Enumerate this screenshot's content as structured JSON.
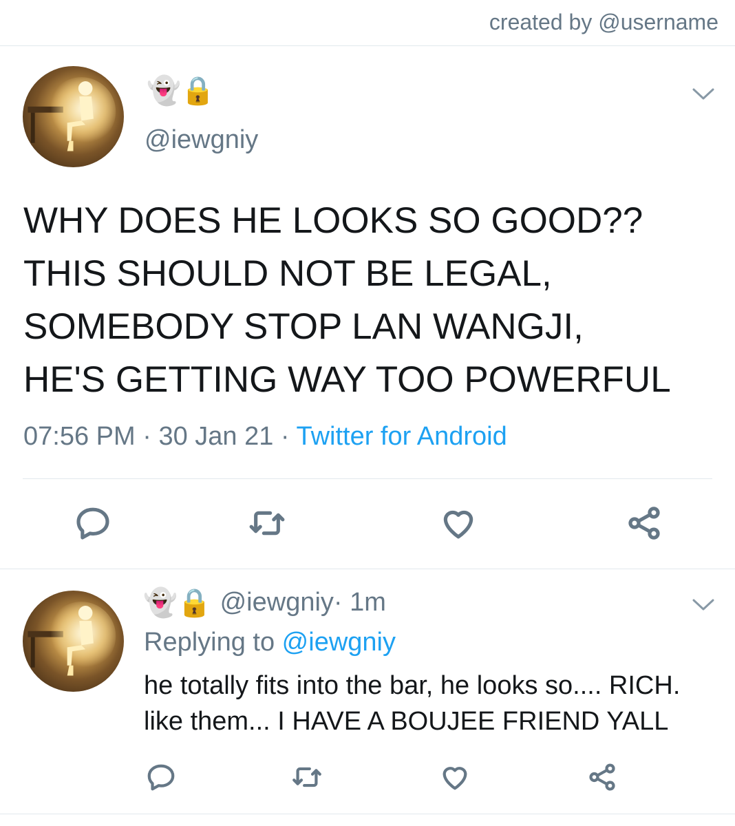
{
  "credit": "created by @username",
  "main_tweet": {
    "emojis": "👻🔒",
    "handle": "@iewgniy",
    "text": "WHY DOES HE LOOKS SO GOOD??\nTHIS SHOULD NOT BE LEGAL,\nSOMEBODY STOP LAN WANGJI,\nHE'S GETTING WAY TOO POWERFUL",
    "time": "07:56 PM",
    "separator": " · ",
    "date": "30 Jan 21",
    "source": "Twitter for Android"
  },
  "reply_tweet": {
    "emojis": "👻🔒",
    "handle": "@iewgniy",
    "age": " · 1m",
    "replying_prefix": "Replying to ",
    "replying_to": "@iewgniy",
    "text": "he totally fits into the bar, he looks so.... RICH.\nlike them... I HAVE A BOUJEE FRIEND YALL"
  },
  "icons": {
    "reply": "reply-icon",
    "retweet": "retweet-icon",
    "like": "heart-icon",
    "share": "share-icon",
    "more": "chevron-down-icon"
  },
  "colors": {
    "text": "#14171a",
    "secondary": "#657786",
    "link": "#1da1f2",
    "divider": "#e1e8ed",
    "lock": "#f5a623"
  }
}
